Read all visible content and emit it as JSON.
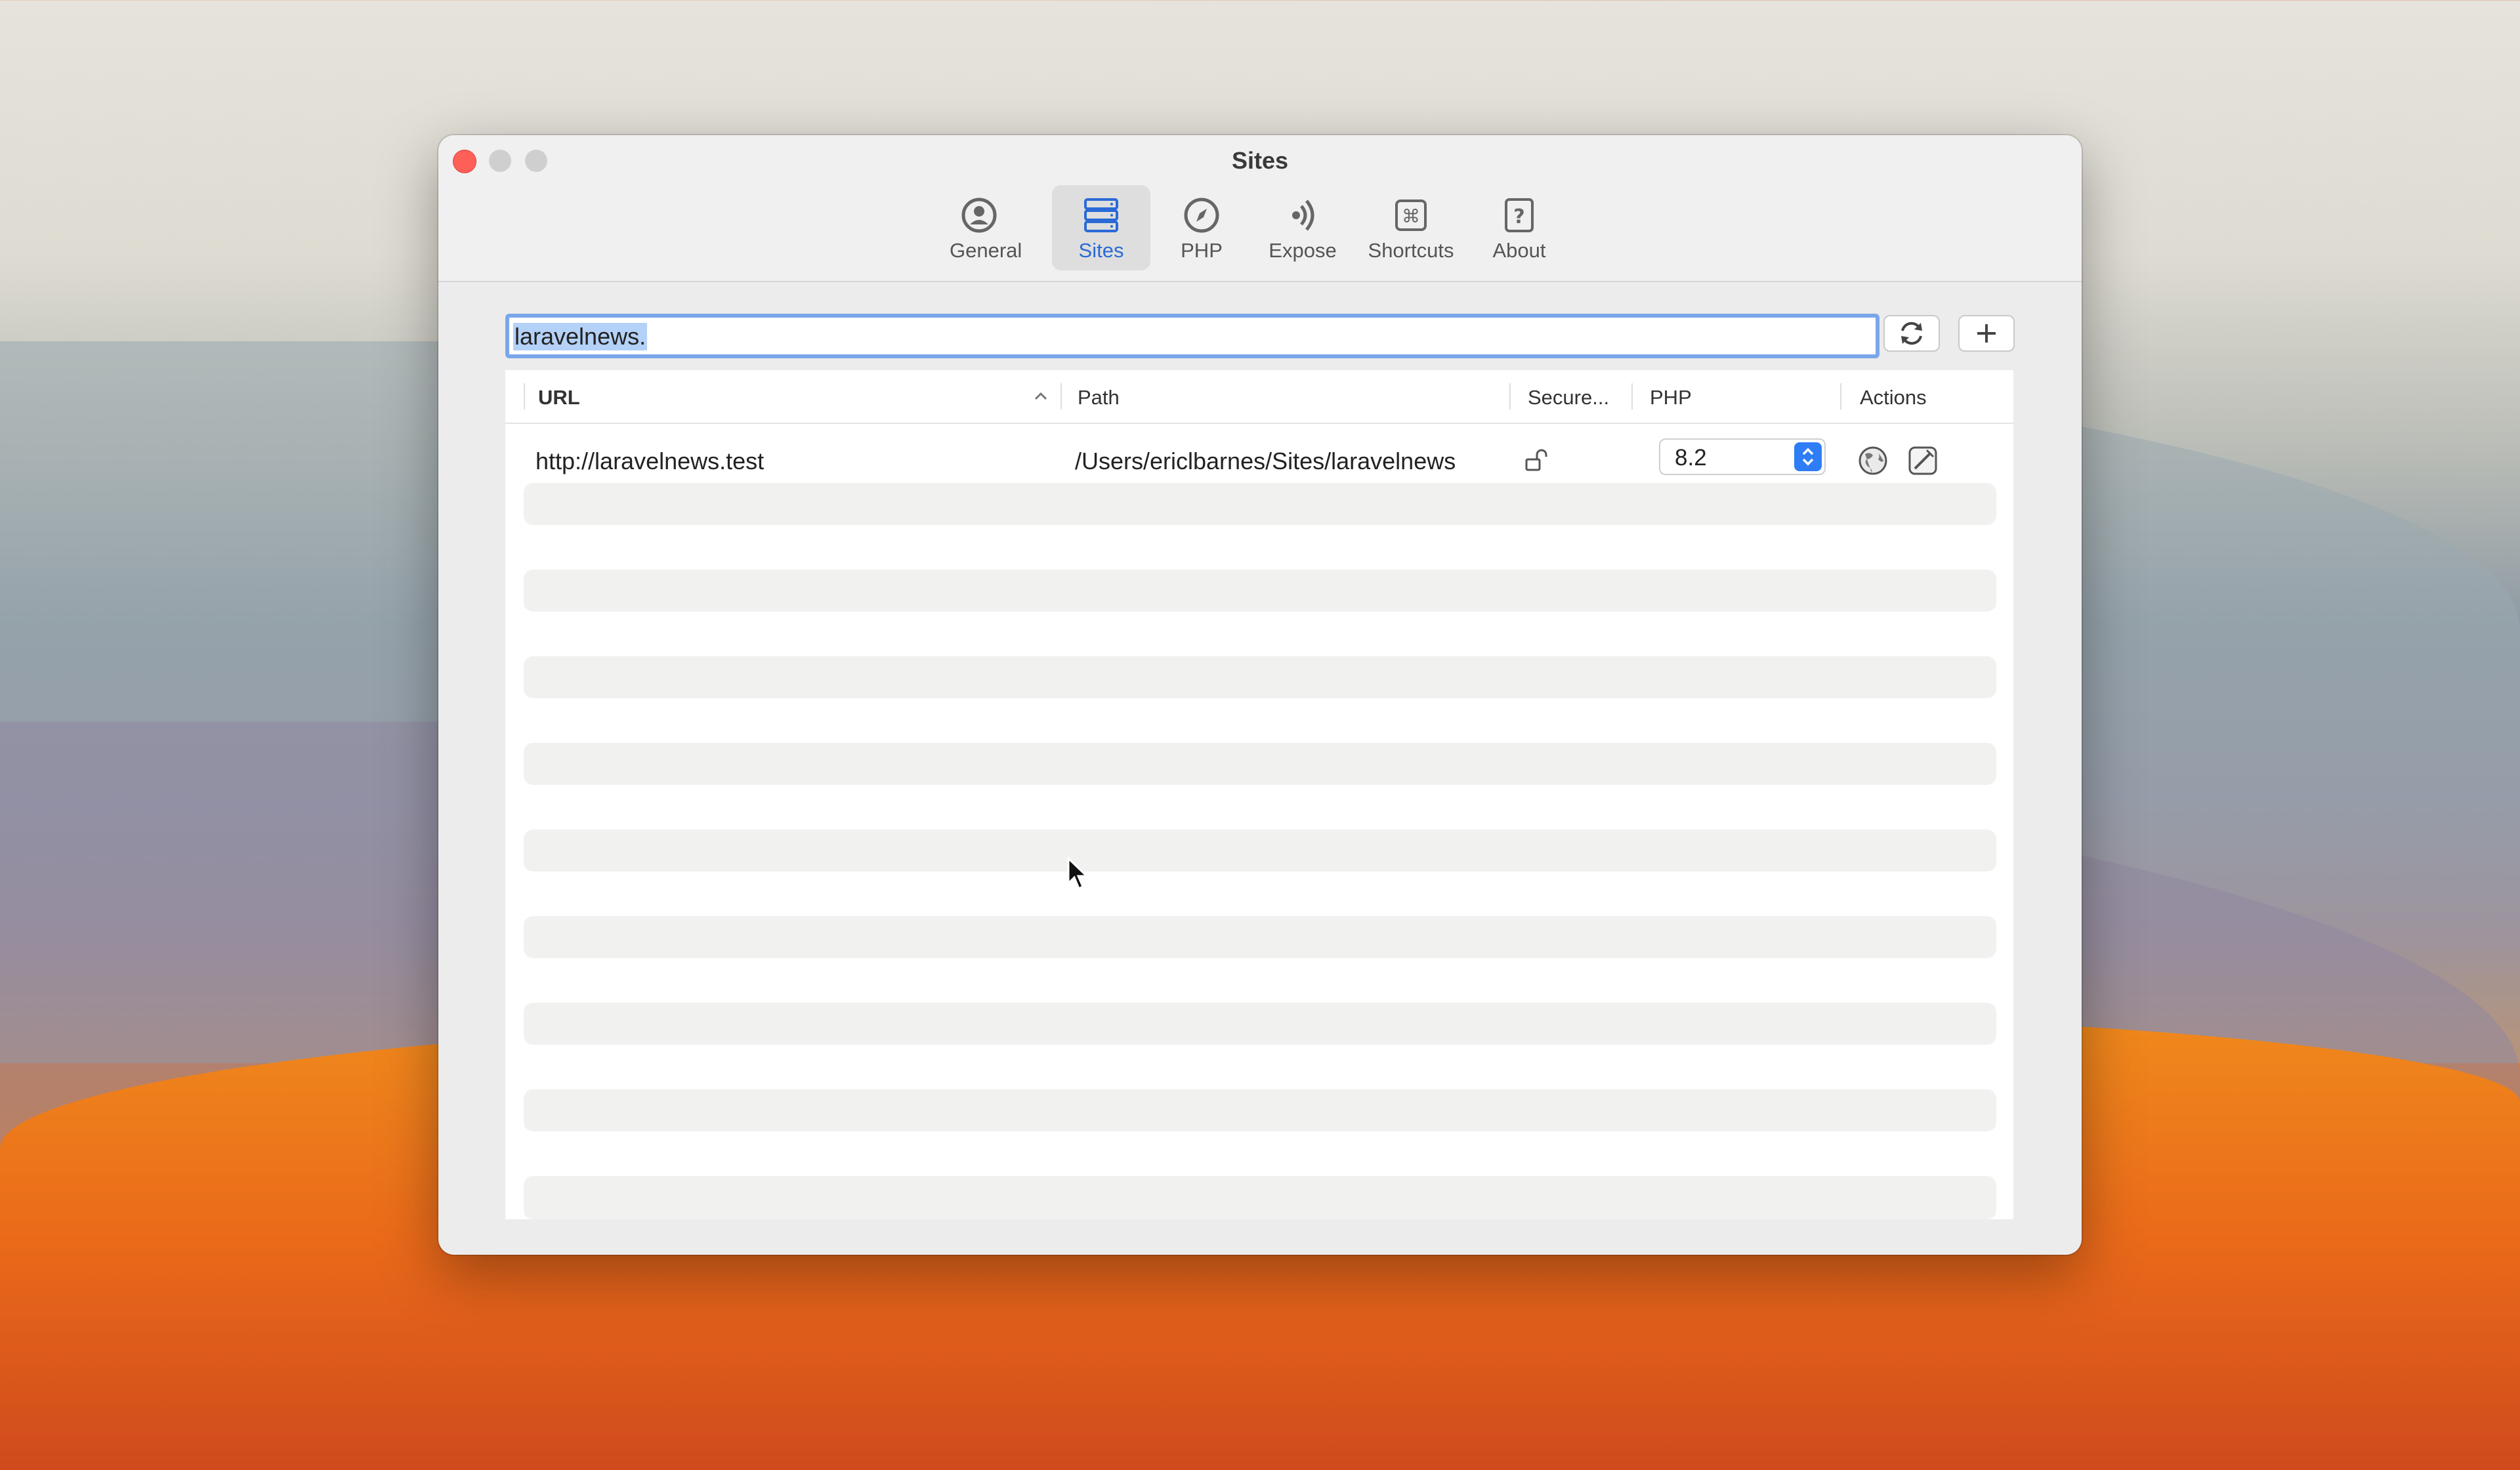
{
  "window": {
    "title": "Sites"
  },
  "toolbar": {
    "tabs": [
      {
        "label": "General",
        "icon": "person-circle-icon"
      },
      {
        "label": "Sites",
        "icon": "server-stack-icon",
        "active": true
      },
      {
        "label": "PHP",
        "icon": "compass-icon"
      },
      {
        "label": "Expose",
        "icon": "broadcast-waves-icon"
      },
      {
        "label": "Shortcuts",
        "icon": "command-key-icon"
      },
      {
        "label": "About",
        "icon": "question-mark-icon"
      }
    ]
  },
  "search": {
    "value": "laravelnews."
  },
  "buttons": {
    "refresh_icon": "refresh-icon",
    "add_icon": "plus-icon"
  },
  "table": {
    "columns": [
      "URL",
      "Path",
      "Secure...",
      "PHP",
      "Actions"
    ],
    "sort": {
      "column": "URL",
      "direction": "ascending"
    },
    "rows": [
      {
        "url": "http://laravelnews.test",
        "path": "/Users/ericlbarnes/Sites/laravelnews",
        "secure_icon": "unlocked-padlock-icon",
        "php": "8.2",
        "actions": [
          "globe-icon",
          "terminal-icon"
        ]
      }
    ]
  },
  "colors": {
    "accent": "#2f7df6",
    "search_focus": "#7aa7e9",
    "close": "#fe5f57"
  }
}
